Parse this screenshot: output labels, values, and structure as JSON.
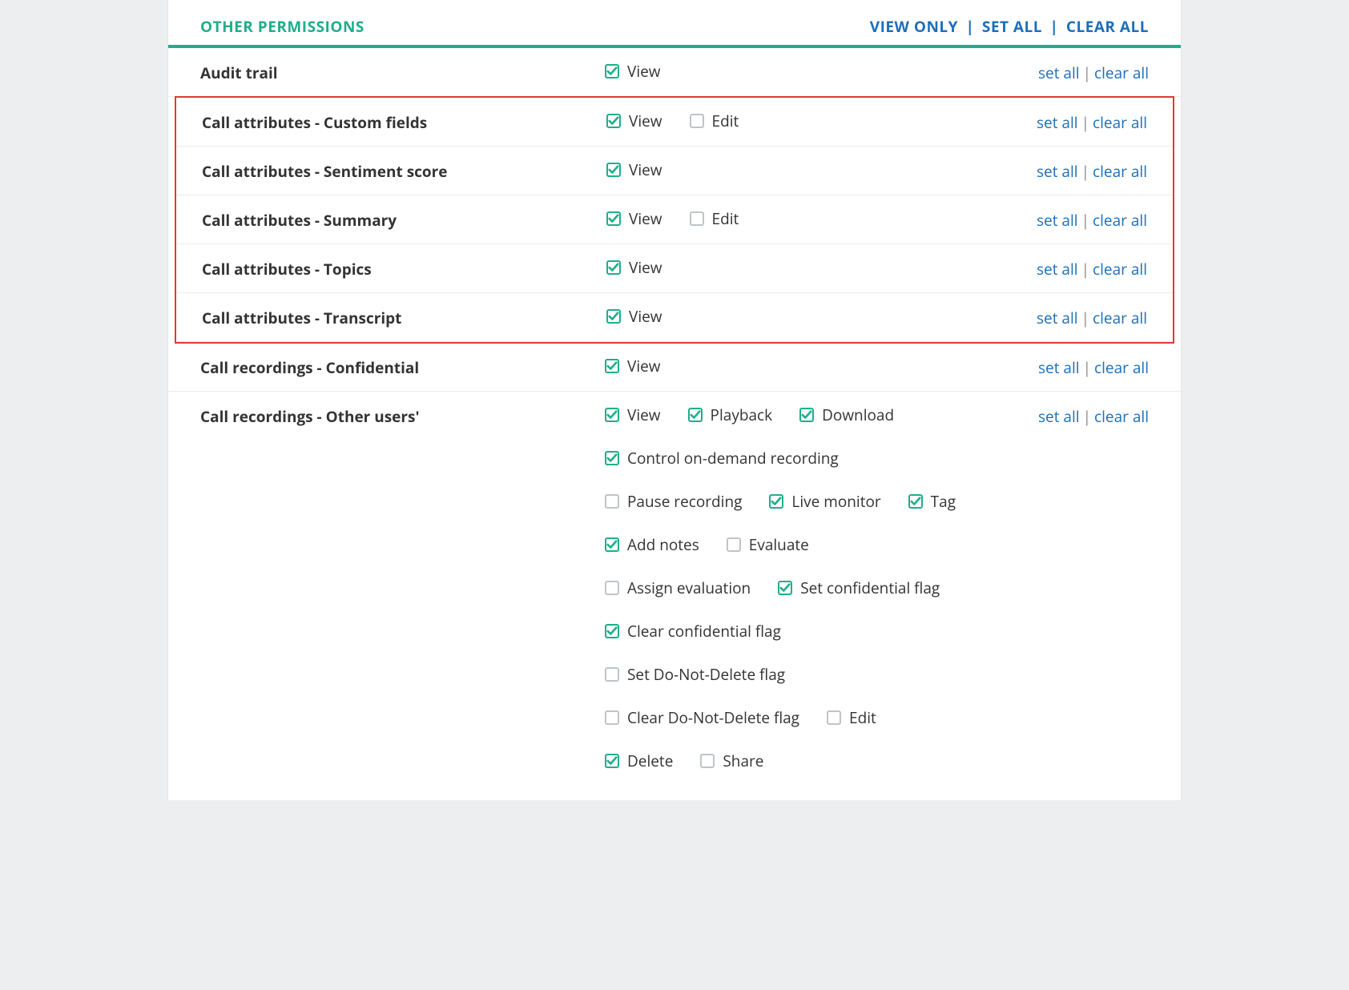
{
  "section_title": "OTHER PERMISSIONS",
  "header_actions": {
    "view_only": "VIEW ONLY",
    "set_all": "SET ALL",
    "clear_all": "CLEAR ALL"
  },
  "row_action_labels": {
    "set_all": "set all",
    "clear_all": "clear all"
  },
  "rows": [
    {
      "id": "audit-trail",
      "name": "Audit trail",
      "highlight": false,
      "perms": [
        {
          "label": "View",
          "checked": true
        }
      ]
    },
    {
      "id": "call-attr-custom-fields",
      "name": "Call attributes - Custom fields",
      "highlight": true,
      "perms": [
        {
          "label": "View",
          "checked": true
        },
        {
          "label": "Edit",
          "checked": false
        }
      ]
    },
    {
      "id": "call-attr-sentiment",
      "name": "Call attributes - Sentiment score",
      "highlight": true,
      "perms": [
        {
          "label": "View",
          "checked": true
        }
      ]
    },
    {
      "id": "call-attr-summary",
      "name": "Call attributes - Summary",
      "highlight": true,
      "perms": [
        {
          "label": "View",
          "checked": true
        },
        {
          "label": "Edit",
          "checked": false
        }
      ]
    },
    {
      "id": "call-attr-topics",
      "name": "Call attributes - Topics",
      "highlight": true,
      "perms": [
        {
          "label": "View",
          "checked": true
        }
      ]
    },
    {
      "id": "call-attr-transcript",
      "name": "Call attributes - Transcript",
      "highlight": true,
      "perms": [
        {
          "label": "View",
          "checked": true
        }
      ]
    },
    {
      "id": "call-rec-confidential",
      "name": "Call recordings - Confidential",
      "highlight": false,
      "perms": [
        {
          "label": "View",
          "checked": true
        }
      ]
    },
    {
      "id": "call-rec-other-users",
      "name": "Call recordings - Other users'",
      "highlight": false,
      "perms": [
        {
          "label": "View",
          "checked": true
        },
        {
          "label": "Playback",
          "checked": true
        },
        {
          "label": "Download",
          "checked": true,
          "break_after": true
        },
        {
          "label": "Control on-demand recording",
          "checked": true,
          "break_after": true
        },
        {
          "label": "Pause recording",
          "checked": false
        },
        {
          "label": "Live monitor",
          "checked": true
        },
        {
          "label": "Tag",
          "checked": true,
          "break_after": true
        },
        {
          "label": "Add notes",
          "checked": true
        },
        {
          "label": "Evaluate",
          "checked": false,
          "break_after": true
        },
        {
          "label": "Assign evaluation",
          "checked": false
        },
        {
          "label": "Set confidential flag",
          "checked": true,
          "break_after": true
        },
        {
          "label": "Clear confidential flag",
          "checked": true,
          "break_after": true
        },
        {
          "label": "Set Do-Not-Delete flag",
          "checked": false,
          "break_after": true
        },
        {
          "label": "Clear Do-Not-Delete flag",
          "checked": false
        },
        {
          "label": "Edit",
          "checked": false,
          "break_after": true
        },
        {
          "label": "Delete",
          "checked": true
        },
        {
          "label": "Share",
          "checked": false
        }
      ]
    }
  ]
}
